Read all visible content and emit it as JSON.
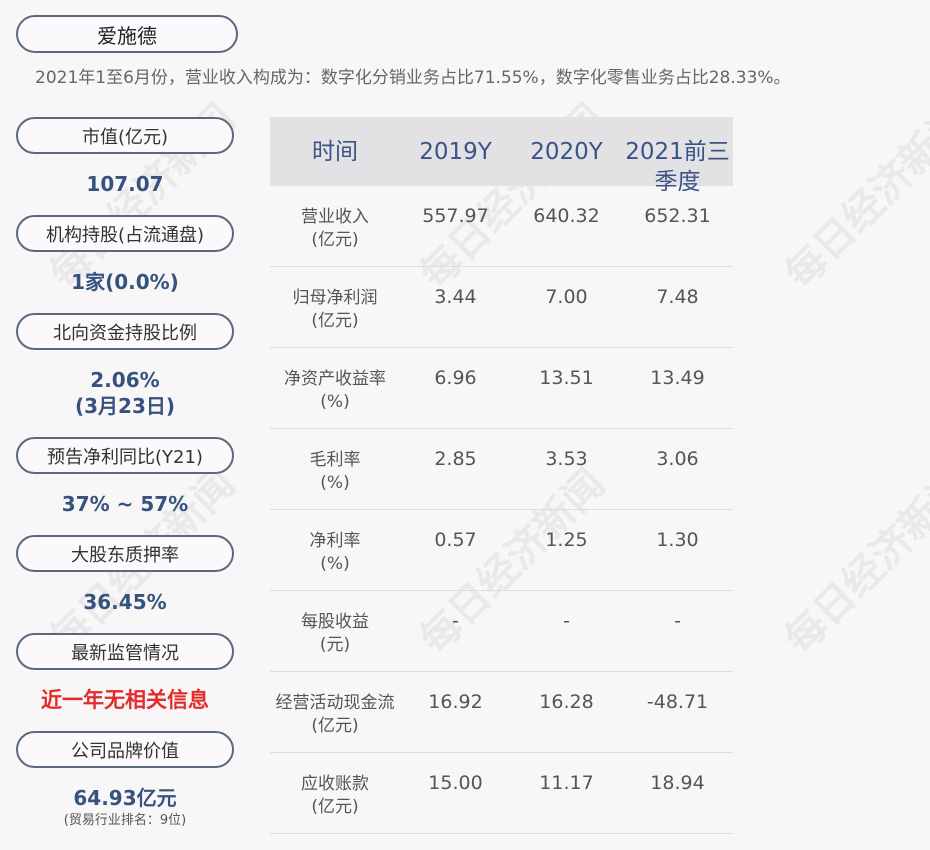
{
  "company_name": "爱施德",
  "summary": "2021年1至6月份，营业收入构成为：数字化分销业务占比71.55%，数字化零售业务占比28.33%。",
  "side": [
    {
      "label": "市值(亿元)",
      "value": "107.07"
    },
    {
      "label": "机构持股(占流通盘)",
      "value": "1家(0.0%)"
    },
    {
      "label": "北向资金持股比例",
      "value": "2.06%",
      "value2": "(3月23日)"
    },
    {
      "label": "预告净利同比(Y21)",
      "value": "37% ~ 57%"
    },
    {
      "label": "大股东质押率",
      "value": "36.45%"
    },
    {
      "label": "最新监管情况",
      "value": "近一年无相关信息"
    },
    {
      "label": "公司品牌价值",
      "value": "64.93亿元",
      "note": "(贸易行业排名：9位)"
    }
  ],
  "table": {
    "headers": [
      "时间",
      "2019Y",
      "2020Y",
      "2021前三",
      "季度"
    ],
    "rows": [
      {
        "label1": "营业收入",
        "label2": "(亿元)",
        "v": [
          "557.97",
          "640.32",
          "652.31"
        ]
      },
      {
        "label1": "归母净利润",
        "label2": "(亿元)",
        "v": [
          "3.44",
          "7.00",
          "7.48"
        ]
      },
      {
        "label1": "净资产收益率",
        "label2": "(%)",
        "v": [
          "6.96",
          "13.51",
          "13.49"
        ]
      },
      {
        "label1": "毛利率",
        "label2": "(%)",
        "v": [
          "2.85",
          "3.53",
          "3.06"
        ]
      },
      {
        "label1": "净利率",
        "label2": "(%)",
        "v": [
          "0.57",
          "1.25",
          "1.30"
        ]
      },
      {
        "label1": "每股收益",
        "label2": "(元)",
        "v": [
          "-",
          "-",
          "-"
        ]
      },
      {
        "label1": "经营活动现金流",
        "label2": "(亿元)",
        "v": [
          "16.92",
          "16.28",
          "-48.71"
        ]
      },
      {
        "label1": "应收账款",
        "label2": "(亿元)",
        "v": [
          "15.00",
          "11.17",
          "18.94"
        ]
      }
    ]
  },
  "watermark": "每日经济新闻"
}
